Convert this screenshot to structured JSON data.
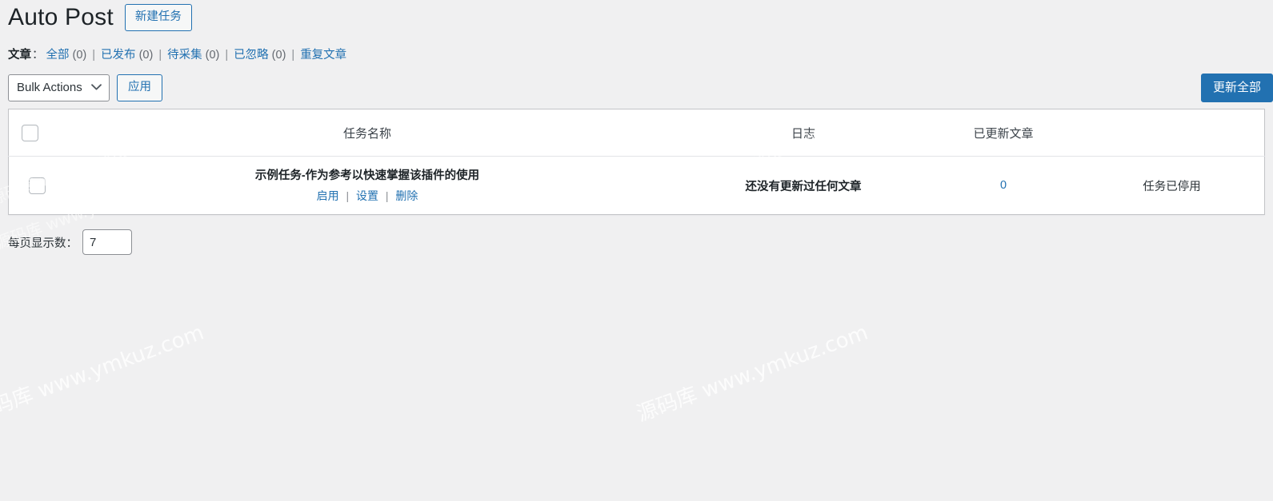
{
  "header": {
    "title": "Auto Post",
    "new_task_button": "新建任务"
  },
  "filters": {
    "label": "文章",
    "colon": "：",
    "separator": "|",
    "items": [
      {
        "label": "全部",
        "count": "(0)"
      },
      {
        "label": "已发布",
        "count": "(0)"
      },
      {
        "label": "待采集",
        "count": "(0)"
      },
      {
        "label": "已忽略",
        "count": "(0)"
      },
      {
        "label": "重复文章",
        "count": ""
      }
    ]
  },
  "tablenav": {
    "bulk_actions_selected": "Bulk Actions",
    "bulk_actions_options": [
      "Bulk Actions"
    ],
    "apply_button": "应用",
    "update_all_button": "更新全部",
    "chevron": "⌄"
  },
  "table": {
    "columns": [
      {
        "key": "cb",
        "label": ""
      },
      {
        "key": "name",
        "label": "任务名称"
      },
      {
        "key": "log",
        "label": "日志"
      },
      {
        "key": "count",
        "label": "已更新文章"
      },
      {
        "key": "status",
        "label": ""
      }
    ],
    "rows": [
      {
        "name": "示例任务-作为参考以快速掌握该插件的使用",
        "actions": [
          "启用",
          "设置",
          "删除"
        ],
        "action_separator": "|",
        "log": "还没有更新过任何文章",
        "count": "0",
        "status": "任务已停用"
      }
    ]
  },
  "per_page": {
    "label": "每页显示数：",
    "value": "7"
  },
  "watermark": {
    "text": "源码库 www.ymkuz.com"
  },
  "colors": {
    "page_background": "#f0f0f1",
    "link": "#2271b1",
    "primary_button": "#2271b1",
    "text": "#2c3338",
    "heading": "#1d2327"
  }
}
